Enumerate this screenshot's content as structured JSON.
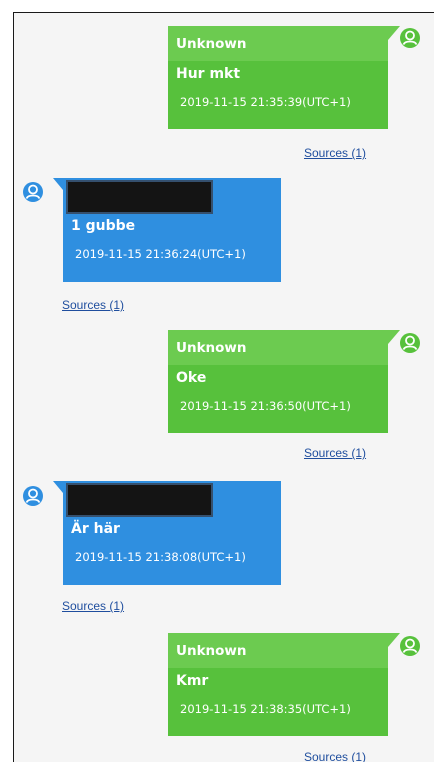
{
  "colors": {
    "incoming_bubble": "#57c13c",
    "incoming_header": "#6ccb50",
    "outgoing_bubble": "#2f8fe0",
    "link": "#1f4e9e"
  },
  "messages": [
    {
      "direction": "incoming",
      "sender": "Unknown",
      "text": "Hur mkt",
      "timestamp": "2019-11-15 21:35:39(UTC+1)",
      "sources": "Sources (1)",
      "avatar_icon": "user-avatar-icon"
    },
    {
      "direction": "outgoing",
      "sender": "",
      "text": "1 gubbe",
      "timestamp": "2019-11-15 21:36:24(UTC+1)",
      "sources": "Sources (1)",
      "avatar_icon": "user-avatar-icon",
      "sender_redacted": true
    },
    {
      "direction": "incoming",
      "sender": "Unknown",
      "text": "Oke",
      "timestamp": "2019-11-15 21:36:50(UTC+1)",
      "sources": "Sources (1)",
      "avatar_icon": "user-avatar-icon"
    },
    {
      "direction": "outgoing",
      "sender": "",
      "text": "Är här",
      "timestamp": "2019-11-15 21:38:08(UTC+1)",
      "sources": "Sources (1)",
      "avatar_icon": "user-avatar-icon",
      "sender_redacted": true
    },
    {
      "direction": "incoming",
      "sender": "Unknown",
      "text": "Kmr",
      "timestamp": "2019-11-15 21:38:35(UTC+1)",
      "sources": "Sources (1)",
      "avatar_icon": "user-avatar-icon"
    }
  ]
}
